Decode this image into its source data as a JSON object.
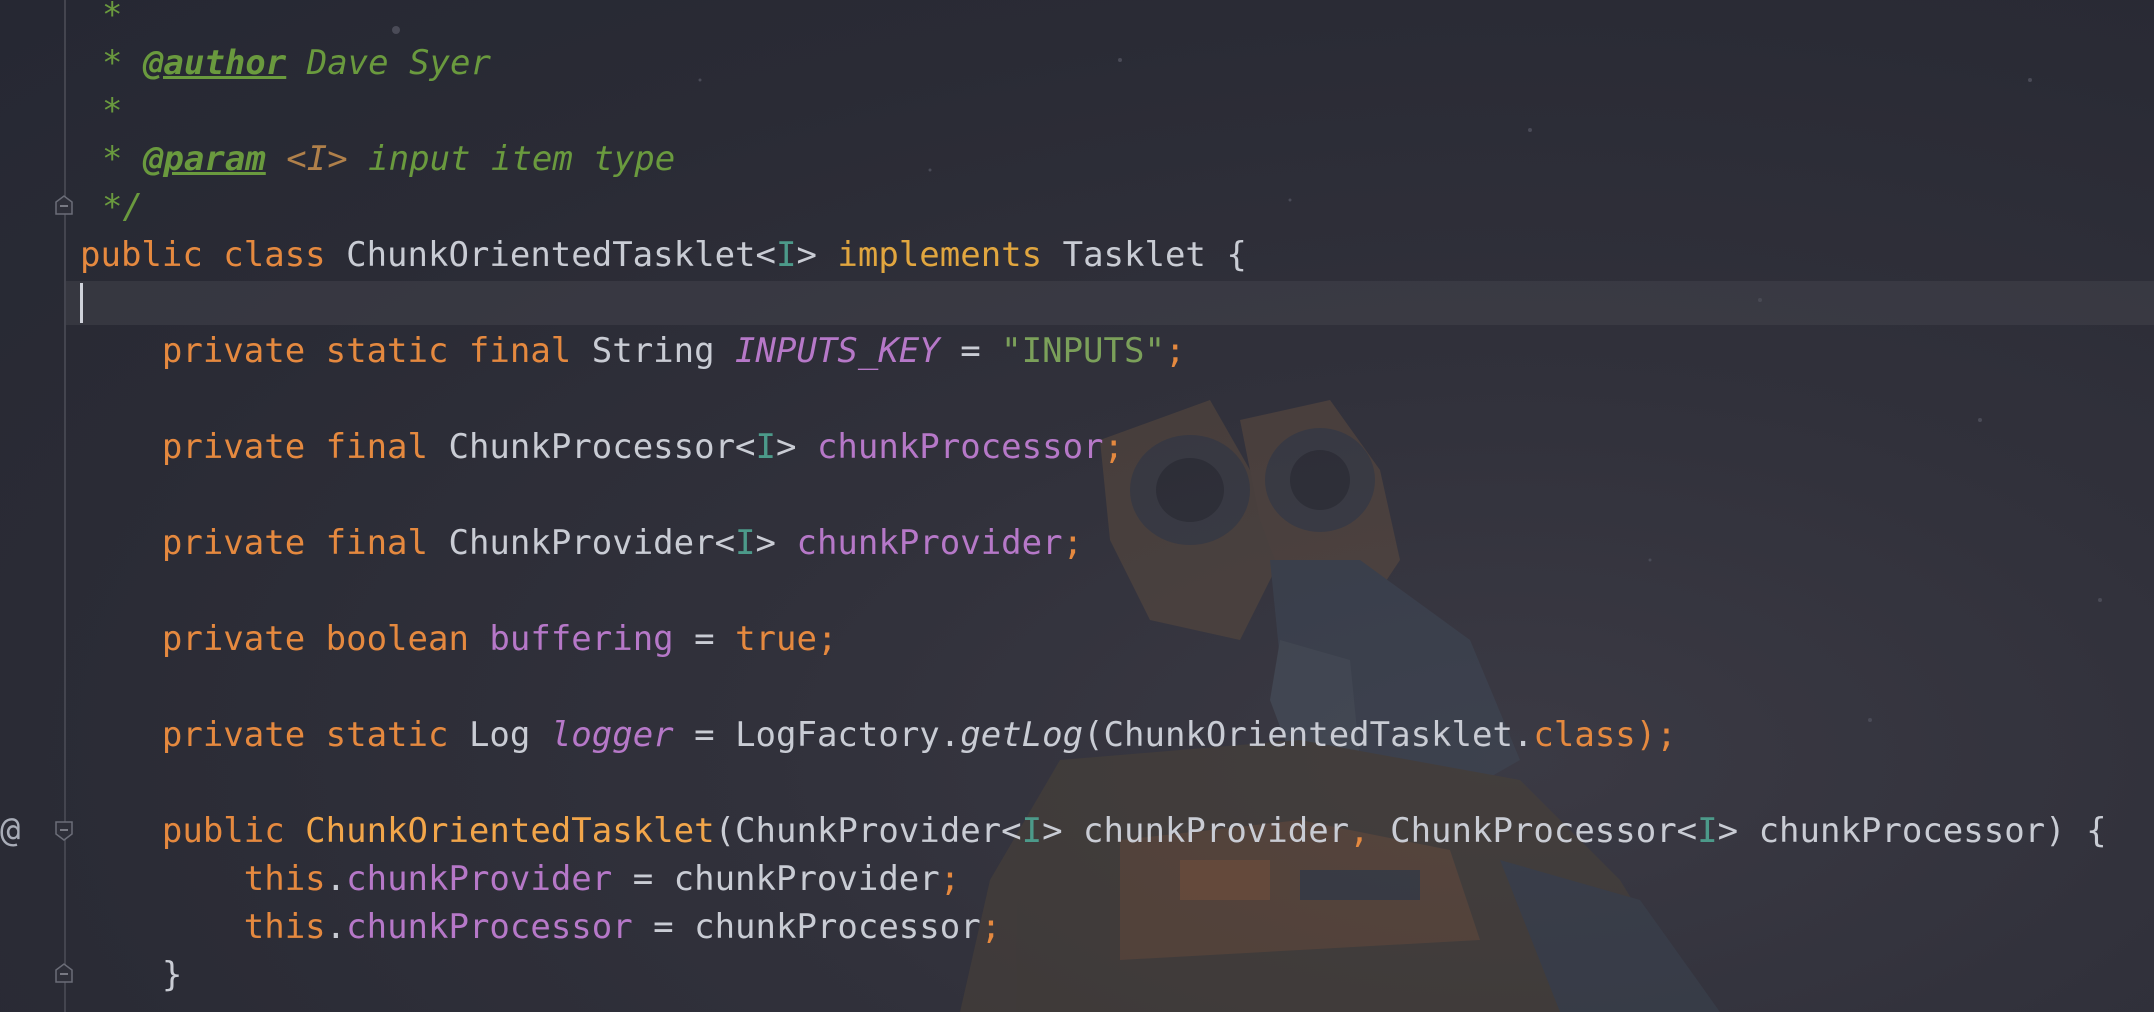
{
  "editor": {
    "language": "Java",
    "gutter": {
      "override_marker": "@"
    },
    "lines": [
      {
        "tokens": [
          {
            "t": "*",
            "c": "cm"
          }
        ]
      },
      {
        "tokens": [
          {
            "t": "* ",
            "c": "cm"
          },
          {
            "t": "@author",
            "c": "cm-tag"
          },
          {
            "t": " Dave Syer",
            "c": "cm"
          }
        ]
      },
      {
        "tokens": [
          {
            "t": "*",
            "c": "cm"
          }
        ]
      },
      {
        "tokens": [
          {
            "t": "* ",
            "c": "cm"
          },
          {
            "t": "@param",
            "c": "cm-tag"
          },
          {
            "t": " ",
            "c": "cm"
          },
          {
            "t": "<I>",
            "c": "cm-type"
          },
          {
            "t": " input item type",
            "c": "cm"
          }
        ]
      },
      {
        "tokens": [
          {
            "t": "*/",
            "c": "cm"
          }
        ]
      },
      {
        "tokens": [
          {
            "t": "public class ",
            "c": "kw"
          },
          {
            "t": "ChunkOrientedTasklet<",
            "c": "cls"
          },
          {
            "t": "I",
            "c": "tp"
          },
          {
            "t": "> ",
            "c": "cls"
          },
          {
            "t": "implements ",
            "c": "kw2"
          },
          {
            "t": "Tasklet {",
            "c": "cls"
          }
        ]
      },
      {
        "tokens": []
      },
      {
        "tokens": [
          {
            "t": "    private static final ",
            "c": "kw"
          },
          {
            "t": "String ",
            "c": "cls"
          },
          {
            "t": "INPUTS_KEY",
            "c": "fld-it"
          },
          {
            "t": " = ",
            "c": "cls"
          },
          {
            "t": "\"INPUTS\"",
            "c": "str"
          },
          {
            "t": ";",
            "c": "sem"
          }
        ]
      },
      {
        "tokens": []
      },
      {
        "tokens": [
          {
            "t": "    private final ",
            "c": "kw"
          },
          {
            "t": "ChunkProcessor<",
            "c": "cls"
          },
          {
            "t": "I",
            "c": "tp"
          },
          {
            "t": "> ",
            "c": "cls"
          },
          {
            "t": "chunkProcessor",
            "c": "fld"
          },
          {
            "t": ";",
            "c": "sem"
          }
        ]
      },
      {
        "tokens": []
      },
      {
        "tokens": [
          {
            "t": "    private final ",
            "c": "kw"
          },
          {
            "t": "ChunkProvider<",
            "c": "cls"
          },
          {
            "t": "I",
            "c": "tp"
          },
          {
            "t": "> ",
            "c": "cls"
          },
          {
            "t": "chunkProvider",
            "c": "fld"
          },
          {
            "t": ";",
            "c": "sem"
          }
        ]
      },
      {
        "tokens": []
      },
      {
        "tokens": [
          {
            "t": "    private boolean ",
            "c": "kw"
          },
          {
            "t": "buffering",
            "c": "fld"
          },
          {
            "t": " = ",
            "c": "cls"
          },
          {
            "t": "true",
            "c": "kw"
          },
          {
            "t": ";",
            "c": "sem"
          }
        ]
      },
      {
        "tokens": []
      },
      {
        "tokens": [
          {
            "t": "    private static ",
            "c": "kw"
          },
          {
            "t": "Log ",
            "c": "cls"
          },
          {
            "t": "logger",
            "c": "fld-it"
          },
          {
            "t": " = LogFactory.",
            "c": "cls"
          },
          {
            "t": "getLog",
            "c": "it"
          },
          {
            "t": "(ChunkOrientedTasklet.",
            "c": "cls"
          },
          {
            "t": "class",
            "c": "kw"
          },
          {
            "t": ");",
            "c": "sem"
          }
        ]
      },
      {
        "tokens": []
      },
      {
        "tokens": [
          {
            "t": "    public ",
            "c": "kw"
          },
          {
            "t": "ChunkOrientedTasklet",
            "c": "meth"
          },
          {
            "t": "(ChunkProvider<",
            "c": "cls"
          },
          {
            "t": "I",
            "c": "tp"
          },
          {
            "t": "> chunkProvider",
            "c": "cls"
          },
          {
            "t": ", ",
            "c": "kw"
          },
          {
            "t": "ChunkProcessor<",
            "c": "cls"
          },
          {
            "t": "I",
            "c": "tp"
          },
          {
            "t": "> chunkProcessor) {",
            "c": "cls"
          }
        ]
      },
      {
        "tokens": [
          {
            "t": "        this",
            "c": "kw"
          },
          {
            "t": ".",
            "c": "cls"
          },
          {
            "t": "chunkProvider",
            "c": "fld"
          },
          {
            "t": " = chunkProvider",
            "c": "cls"
          },
          {
            "t": ";",
            "c": "sem"
          }
        ]
      },
      {
        "tokens": [
          {
            "t": "        this",
            "c": "kw"
          },
          {
            "t": ".",
            "c": "cls"
          },
          {
            "t": "chunkProcessor",
            "c": "fld"
          },
          {
            "t": " = chunkProcessor",
            "c": "cls"
          },
          {
            "t": ";",
            "c": "sem"
          }
        ]
      },
      {
        "tokens": [
          {
            "t": "    }",
            "c": "cls"
          }
        ]
      }
    ]
  }
}
